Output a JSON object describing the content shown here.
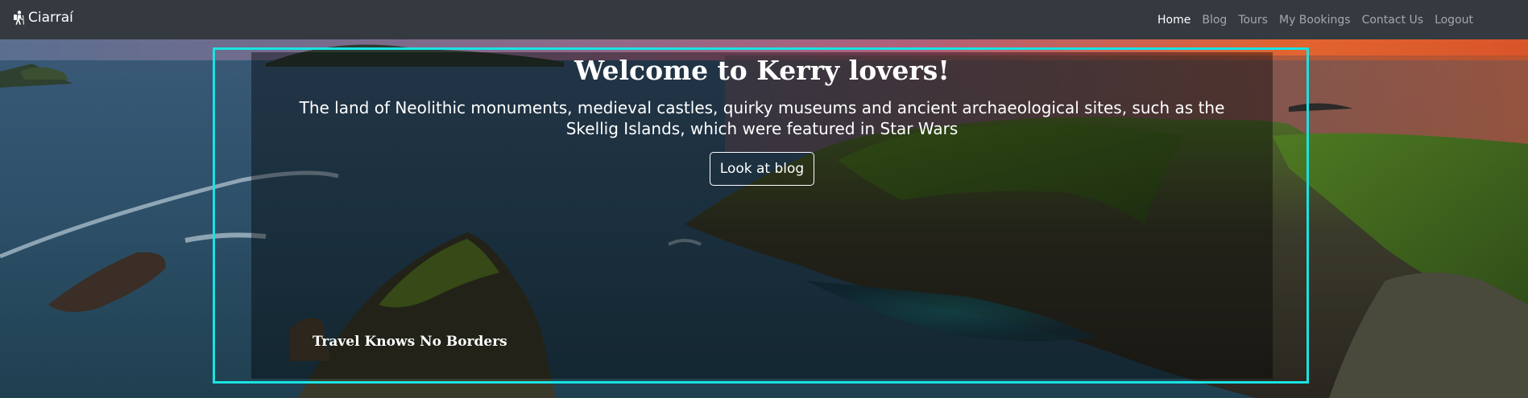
{
  "navbar": {
    "brand": "Ciarraí",
    "brand_icon": "hiker-icon",
    "links": [
      {
        "label": "Home",
        "active": true
      },
      {
        "label": "Blog",
        "active": false
      },
      {
        "label": "Tours",
        "active": false
      },
      {
        "label": "My Bookings",
        "active": false
      },
      {
        "label": "Contact Us",
        "active": false
      },
      {
        "label": "Logout",
        "active": false
      }
    ]
  },
  "hero": {
    "title": "Welcome to Kerry lovers!",
    "subtitle": "The land of Neolithic monuments, medieval castles, quirky museums and ancient archaeological sites, such as the Skellig Islands, which were featured in Star Wars",
    "button_label": "Look at blog",
    "tagline": "Travel Knows No Borders"
  },
  "colors": {
    "navbar_bg": "#343a40",
    "highlight_frame": "#19e3e3",
    "text": "#ffffff"
  }
}
